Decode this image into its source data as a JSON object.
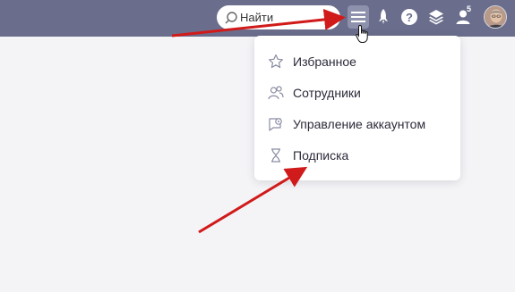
{
  "header": {
    "search": {
      "label": "Найти",
      "icon": "search-icon"
    },
    "icons": [
      "menu-icon",
      "rocket-icon",
      "help-icon",
      "layers-icon",
      "user-icon",
      "avatar"
    ],
    "notification_badge": "5",
    "colors": {
      "topbar": "#6a6e8c",
      "menu_button_active": "#8d91ac"
    }
  },
  "dropdown": {
    "items": [
      {
        "label": "Избранное",
        "icon": "star-icon"
      },
      {
        "label": "Сотрудники",
        "icon": "people-icon"
      },
      {
        "label": "Управление аккаунтом",
        "icon": "account-settings-icon"
      },
      {
        "label": "Подписка",
        "icon": "hourglass-icon"
      }
    ]
  },
  "annotations": {
    "arrow_color": "#d11a1a"
  }
}
